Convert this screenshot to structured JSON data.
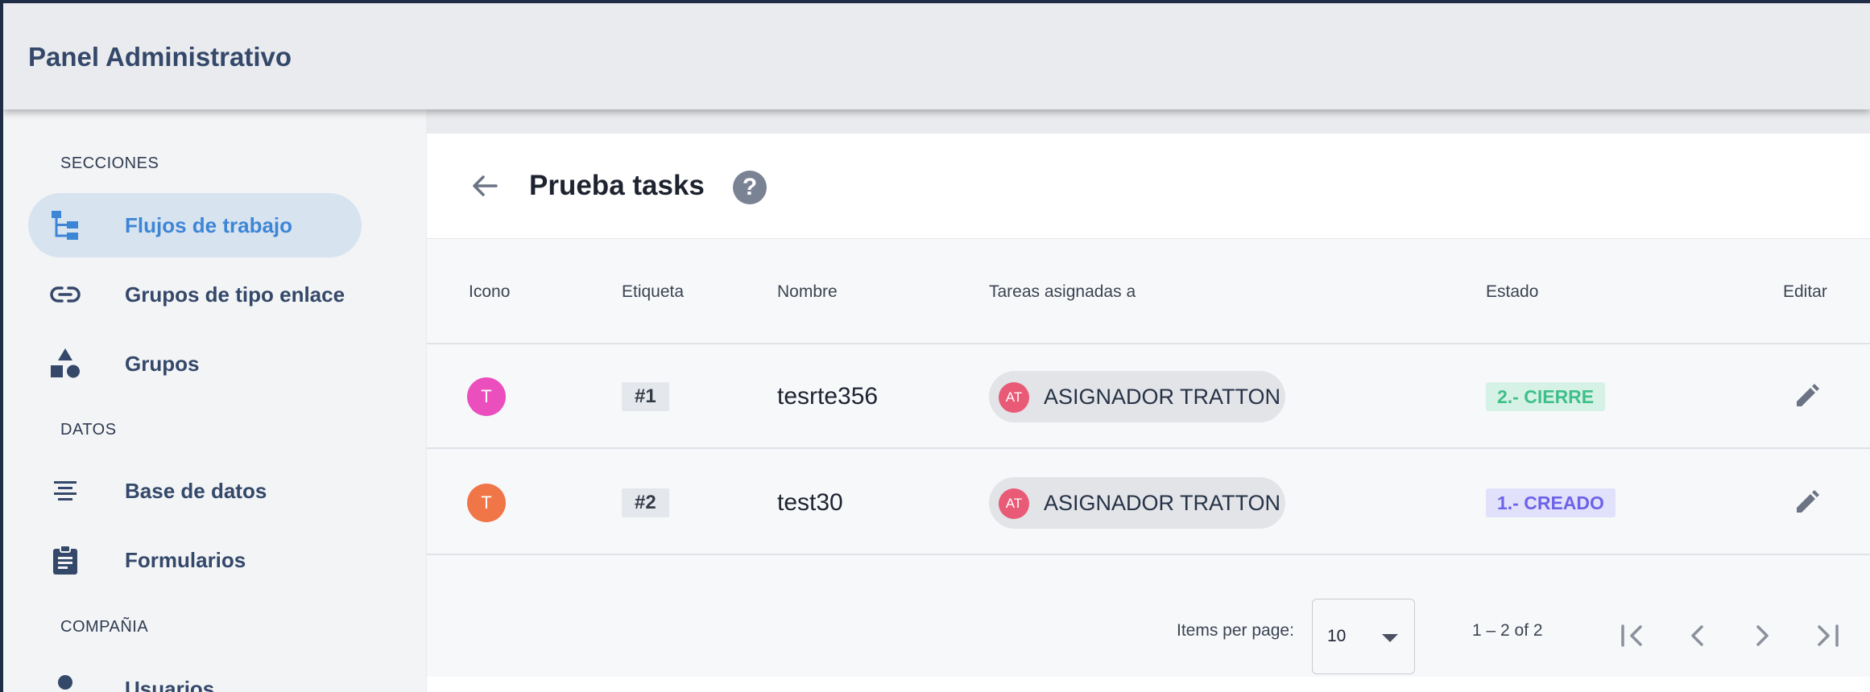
{
  "header": {
    "title": "Panel Administrativo"
  },
  "sidebar": {
    "sections": [
      {
        "label": "SECCIONES"
      },
      {
        "label": "DATOS"
      },
      {
        "label": "COMPAÑIA"
      }
    ],
    "items": [
      {
        "label": "Flujos de trabajo",
        "icon": "workflow-tree-icon",
        "active": true
      },
      {
        "label": "Grupos de tipo enlace",
        "icon": "link-icon"
      },
      {
        "label": "Grupos",
        "icon": "shapes-icon"
      },
      {
        "label": "Base de datos",
        "icon": "align-center-icon"
      },
      {
        "label": "Formularios",
        "icon": "clipboard-icon"
      },
      {
        "label": "Usuarios",
        "icon": "person-icon"
      }
    ]
  },
  "page": {
    "title": "Prueba tasks",
    "help_symbol": "?"
  },
  "table": {
    "headers": {
      "icon": "Icono",
      "tag": "Etiqueta",
      "name": "Nombre",
      "assigned": "Tareas asignadas a",
      "status": "Estado",
      "edit": "Editar"
    },
    "rows": [
      {
        "avatar": "T",
        "avatar_color": "#ea4fbd",
        "tag": "#1",
        "name": "tesrte356",
        "assignee_initials": "AT",
        "assignee": "ASIGNADOR TRATTON",
        "status": "2.- CIERRE",
        "status_color": "#3fbf8a",
        "status_bg": "#d6f1e5"
      },
      {
        "avatar": "T",
        "avatar_color": "#f07547",
        "tag": "#2",
        "name": "test30",
        "assignee_initials": "AT",
        "assignee": "ASIGNADOR TRATTON",
        "status": "1.- CREADO",
        "status_color": "#6c63e8",
        "status_bg": "#e2e1fb"
      }
    ]
  },
  "paginator": {
    "items_per_page_label": "Items per page:",
    "page_size": "10",
    "range": "1 – 2 of 2"
  },
  "colors": {
    "accent": "#3d86d6",
    "active_nav_bg": "#d8e3f0",
    "sidebar_text": "#34486a"
  }
}
